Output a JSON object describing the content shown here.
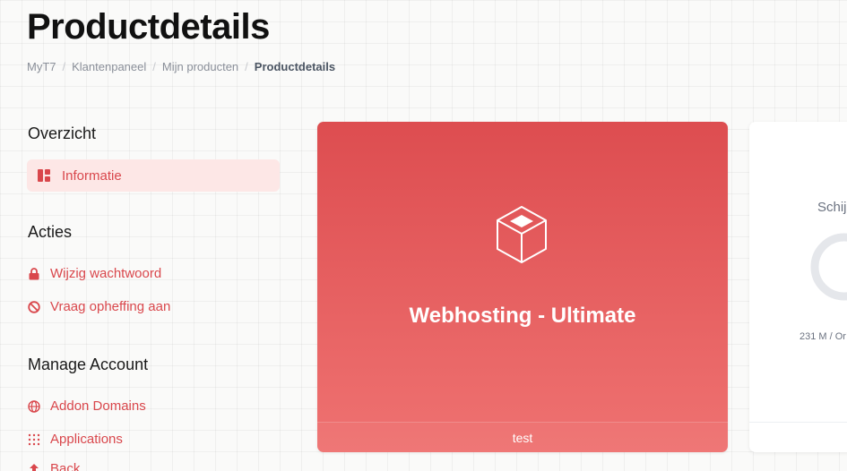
{
  "page": {
    "title": "Productdetails"
  },
  "breadcrumb": {
    "items": [
      "MyT7",
      "Klantenpaneel",
      "Mijn producten"
    ],
    "current": "Productdetails",
    "separator": "/"
  },
  "sidebar": {
    "overview": {
      "heading": "Overzicht",
      "items": [
        {
          "label": "Informatie",
          "icon": "dashboard-icon",
          "active": true
        }
      ]
    },
    "actions": {
      "heading": "Acties",
      "items": [
        {
          "label": "Wijzig wachtwoord",
          "icon": "lock-icon"
        },
        {
          "label": "Vraag opheffing aan",
          "icon": "ban-icon"
        }
      ]
    },
    "manage": {
      "heading": "Manage Account",
      "items": [
        {
          "label": "Addon Domains",
          "icon": "globe-icon"
        },
        {
          "label": "Applications",
          "icon": "grid-dots-icon"
        },
        {
          "label": "Back",
          "icon": "upload-icon"
        }
      ]
    }
  },
  "product_card": {
    "icon": "box-icon",
    "name": "Webhosting - Ultimate",
    "footer_text": "test"
  },
  "disk_card": {
    "title": "Schij",
    "usage_text": "231 M / Or",
    "icon": "gauge-icon"
  },
  "colors": {
    "accent": "#d9474c",
    "accent_soft": "#fde7e6",
    "card_gradient_top": "#dd4d50",
    "card_gradient_bottom": "#ef7271",
    "title": "#111111",
    "muted": "#8a8f99"
  }
}
